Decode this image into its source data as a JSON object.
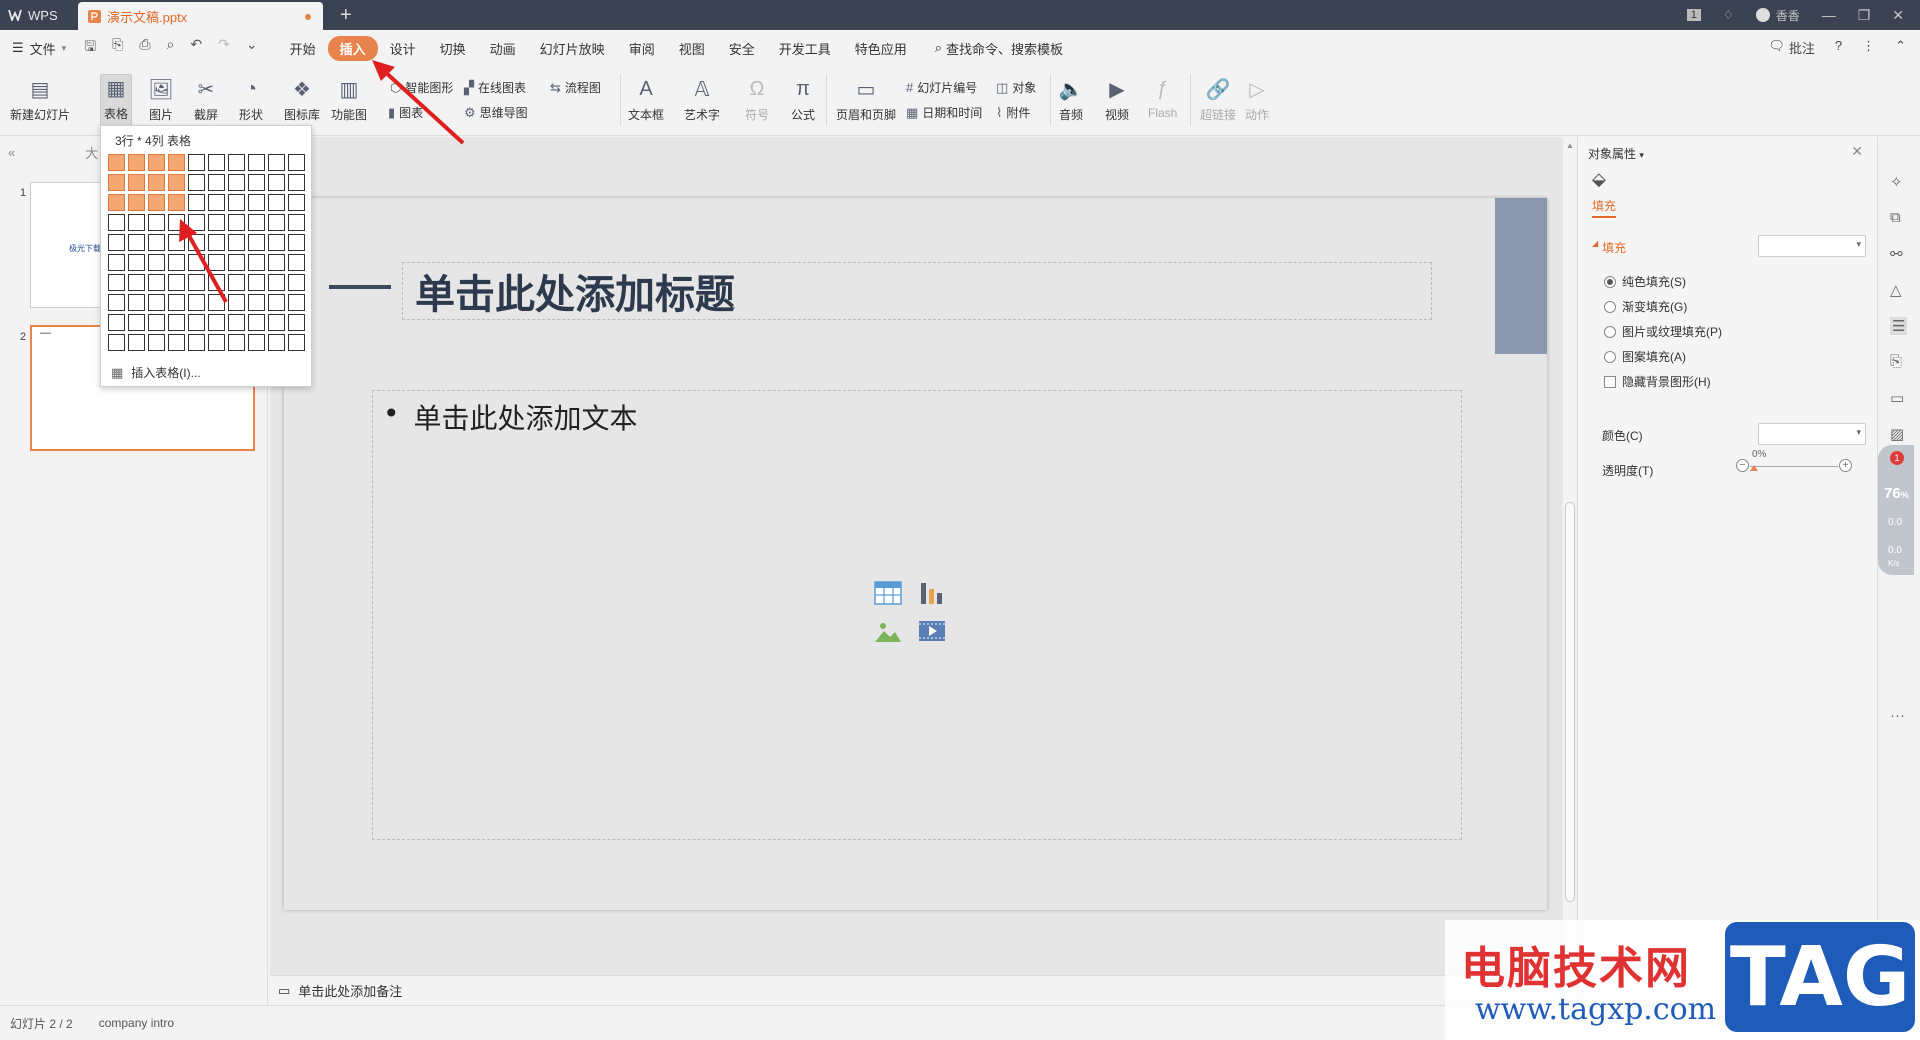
{
  "titlebar": {
    "app": "WPS",
    "doc_tab": "演示文稿.pptx",
    "new_tab": "+",
    "user": "香香",
    "badge": "1"
  },
  "menubar": {
    "file": "文件",
    "tabs": [
      "开始",
      "插入",
      "设计",
      "切换",
      "动画",
      "幻灯片放映",
      "审阅",
      "视图",
      "安全",
      "开发工具",
      "特色应用"
    ],
    "active_tab": "插入",
    "search": "查找命令、搜索模板",
    "comment": "批注"
  },
  "ribbon": {
    "new_slide": "新建幻灯片",
    "table": "表格",
    "picture": "图片",
    "screenshot": "截屏",
    "shape": "形状",
    "icon_lib": "图标库",
    "func_chart": "功能图",
    "smart_shape": "智能图形",
    "online_chart": "在线图表",
    "flowchart": "流程图",
    "chart": "图表",
    "mindmap": "思维导图",
    "textbox": "文本框",
    "wordart": "艺术字",
    "symbol": "符号",
    "formula": "公式",
    "header_footer": "页眉和页脚",
    "slide_number": "幻灯片编号",
    "object": "对象",
    "datetime": "日期和时间",
    "attachment": "附件",
    "audio": "音频",
    "video": "视频",
    "flash": "Flash",
    "hyperlink": "超链接",
    "action": "动作"
  },
  "table_dropdown": {
    "label": "3行 * 4列 表格",
    "rows": 10,
    "cols": 10,
    "selected_rows": 3,
    "selected_cols": 4,
    "insert_table": "插入表格(I)..."
  },
  "leftpanel": {
    "header": "大",
    "slides": [
      {
        "num": "1",
        "text": "极光下载"
      },
      {
        "num": "2",
        "text": "—"
      }
    ]
  },
  "slide": {
    "title_placeholder": "单击此处添加标题",
    "body_placeholder": "单击此处添加文本",
    "bullet": "•"
  },
  "notes": {
    "placeholder": "单击此处添加备注"
  },
  "statusbar": {
    "slide_pos": "幻灯片 2 / 2",
    "theme": "company intro"
  },
  "properties": {
    "title": "对象属性",
    "tab_fill": "填充",
    "section_fill": "填充",
    "options": [
      "纯色填充(S)",
      "渐变填充(G)",
      "图片或纹理填充(P)",
      "图案填充(A)"
    ],
    "selected_option": 0,
    "hide_bg": "隐藏背景图形(H)",
    "color_label": "颜色(C)",
    "transparency_label": "透明度(T)",
    "transparency_value": "0%"
  },
  "speed_widget": {
    "badge": "1",
    "percent": "76",
    "unit": "%",
    "up": "0.0",
    "down": "0.0",
    "rate_unit": "K/s"
  },
  "watermark": {
    "site_cn": "电脑技术网",
    "site_url": "www.tagxp.com",
    "tag": "TAG"
  },
  "colors": {
    "accent": "#e8834c",
    "titlebar": "#3b4252",
    "slide_bar": "#8a97ad",
    "arrow": "#e02020"
  }
}
